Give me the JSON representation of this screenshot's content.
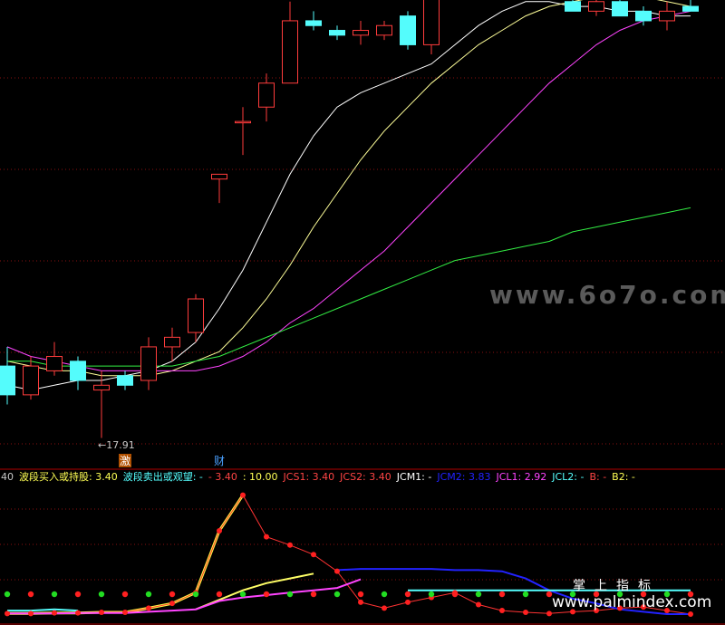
{
  "watermark_main": "www.6o7o.com",
  "watermark_site": "www.palmindex.com",
  "watermark_cn": "掌上指标",
  "price_marker": {
    "label": "←17.91",
    "value": 17.91,
    "index": 4
  },
  "panel_markers": [
    {
      "text": "激",
      "index": 5,
      "color": "#ffffff",
      "bg": "#b05000"
    },
    {
      "text": "财",
      "index": 9,
      "color": "#4aa0ff",
      "bg": ""
    }
  ],
  "indicator_bar": [
    {
      "text": "40",
      "color": "#c8c8c8"
    },
    {
      "text": "波段买入或持股: 3.40",
      "color": "#ffff55"
    },
    {
      "text": "波段卖出或观望: -",
      "color": "#55ffff"
    },
    {
      "text": "- 3.40",
      "color": "#ff4444"
    },
    {
      "text": ": 10.00",
      "color": "#ffff55"
    },
    {
      "text": "JCS1: 3.40",
      "color": "#ff4444"
    },
    {
      "text": "JCS2: 3.40",
      "color": "#ff4444"
    },
    {
      "text": "JCM1: -",
      "color": "#ffffff"
    },
    {
      "text": "JCM2: 3.83",
      "color": "#2222ff"
    },
    {
      "text": "JCL1: 2.92",
      "color": "#ff44ff"
    },
    {
      "text": "JCL2: -",
      "color": "#55ffff"
    },
    {
      "text": "B: -",
      "color": "#ff4444"
    },
    {
      "text": "B2: -",
      "color": "#ffff55"
    }
  ],
  "chart_data": [
    {
      "type": "candlestick",
      "title": "",
      "ylim": [
        17.4,
        27.6
      ],
      "grid": "horizontal dotted",
      "colors": {
        "up": "#ff3c3c",
        "down": "#54fcfc"
      },
      "candles": [
        {
          "open": 19.4,
          "high": 19.8,
          "low": 18.6,
          "close": 18.8
        },
        {
          "open": 18.8,
          "high": 19.6,
          "low": 18.7,
          "close": 19.4
        },
        {
          "open": 19.3,
          "high": 19.9,
          "low": 19.2,
          "close": 19.6
        },
        {
          "open": 19.5,
          "high": 19.6,
          "low": 18.9,
          "close": 19.1
        },
        {
          "open": 18.9,
          "high": 19.3,
          "low": 17.9,
          "close": 19.0
        },
        {
          "open": 19.2,
          "high": 19.3,
          "low": 18.9,
          "close": 19.0
        },
        {
          "open": 19.1,
          "high": 20.0,
          "low": 18.9,
          "close": 19.8
        },
        {
          "open": 19.8,
          "high": 20.2,
          "low": 19.5,
          "close": 20.0
        },
        {
          "open": 20.1,
          "high": 20.9,
          "low": 19.9,
          "close": 20.8
        },
        {
          "open": 23.3,
          "high": 23.4,
          "low": 22.8,
          "close": 23.4
        },
        {
          "open": 24.5,
          "high": 24.8,
          "low": 23.8,
          "close": 24.5
        },
        {
          "open": 24.8,
          "high": 25.5,
          "low": 24.5,
          "close": 25.3
        },
        {
          "open": 25.3,
          "high": 27.0,
          "low": 25.3,
          "close": 26.6
        },
        {
          "open": 26.6,
          "high": 26.8,
          "low": 26.4,
          "close": 26.5
        },
        {
          "open": 26.4,
          "high": 26.5,
          "low": 26.2,
          "close": 26.3
        },
        {
          "open": 26.3,
          "high": 26.6,
          "low": 26.1,
          "close": 26.4
        },
        {
          "open": 26.3,
          "high": 26.6,
          "low": 26.2,
          "close": 26.5
        },
        {
          "open": 26.7,
          "high": 26.8,
          "low": 26.0,
          "close": 26.1
        },
        {
          "open": 26.1,
          "high": 27.4,
          "low": 25.9,
          "close": 27.4
        },
        {
          "open": 27.3,
          "high": 28.6,
          "low": 27.2,
          "close": 27.3
        },
        {
          "open": 27.3,
          "high": 27.6,
          "low": 27.2,
          "close": 27.5
        },
        {
          "open": 27.4,
          "high": 27.8,
          "low": 27.3,
          "close": 27.8
        },
        {
          "open": 27.6,
          "high": 27.9,
          "low": 27.6,
          "close": 27.5
        },
        {
          "open": 27.5,
          "high": 27.6,
          "low": 27.1,
          "close": 27.1
        },
        {
          "open": 27.0,
          "high": 27.1,
          "low": 26.8,
          "close": 26.8
        },
        {
          "open": 26.8,
          "high": 27.1,
          "low": 26.7,
          "close": 27.0
        },
        {
          "open": 27.0,
          "high": 27.1,
          "low": 26.7,
          "close": 26.7
        },
        {
          "open": 26.8,
          "high": 26.9,
          "low": 26.5,
          "close": 26.6
        },
        {
          "open": 26.6,
          "high": 27.0,
          "low": 26.4,
          "close": 26.8
        },
        {
          "open": 26.9,
          "high": 27.2,
          "low": 26.8,
          "close": 26.8
        }
      ],
      "series": [
        {
          "color": "#ffffff",
          "values": [
            19.0,
            18.9,
            19.0,
            19.1,
            19.1,
            19.2,
            19.3,
            19.5,
            19.9,
            20.6,
            21.4,
            22.4,
            23.4,
            24.2,
            24.8,
            25.1,
            25.3,
            25.5,
            25.7,
            26.1,
            26.5,
            26.8,
            27.0,
            27.0,
            26.9,
            26.9,
            26.8,
            26.8,
            26.7,
            26.7
          ]
        },
        {
          "color": "#ffff99",
          "values": [
            19.5,
            19.4,
            19.3,
            19.3,
            19.2,
            19.2,
            19.2,
            19.3,
            19.5,
            19.7,
            20.2,
            20.8,
            21.5,
            22.3,
            23.0,
            23.7,
            24.3,
            24.8,
            25.3,
            25.7,
            26.1,
            26.4,
            26.7,
            26.9,
            27.0,
            27.1,
            27.1,
            27.1,
            27.0,
            26.9
          ]
        },
        {
          "color": "#ff44ff",
          "values": [
            19.8,
            19.6,
            19.5,
            19.4,
            19.3,
            19.3,
            19.3,
            19.3,
            19.3,
            19.4,
            19.6,
            19.9,
            20.3,
            20.6,
            21.0,
            21.4,
            21.8,
            22.3,
            22.8,
            23.3,
            23.8,
            24.3,
            24.8,
            25.3,
            25.7,
            26.1,
            26.4,
            26.6,
            26.7,
            26.8
          ]
        },
        {
          "color": "#33ee44",
          "values": [
            19.5,
            19.5,
            19.4,
            19.4,
            19.4,
            19.4,
            19.4,
            19.4,
            19.5,
            19.6,
            19.8,
            20.0,
            20.2,
            20.4,
            20.6,
            20.8,
            21.0,
            21.2,
            21.4,
            21.6,
            21.7,
            21.8,
            21.9,
            22.0,
            22.2,
            22.3,
            22.4,
            22.5,
            22.6,
            22.7
          ]
        }
      ]
    },
    {
      "type": "line",
      "title": "",
      "ylim": [
        0,
        10.5
      ],
      "grid": "horizontal dotted",
      "series": [
        {
          "name": "JCS1",
          "color": "#ffff44",
          "values": [
            0.05,
            0.05,
            0.1,
            0.1,
            0.15,
            0.15,
            0.5,
            0.9,
            1.8,
            7.0,
            10.0,
            null,
            null,
            null,
            null,
            null,
            null,
            null,
            null,
            null,
            null,
            null,
            null,
            null,
            null,
            null,
            null,
            null,
            null,
            null
          ]
        },
        {
          "name": "JCM1",
          "color": "#ffff66",
          "values": [
            null,
            null,
            null,
            null,
            null,
            null,
            null,
            null,
            0.4,
            1.2,
            2.0,
            2.6,
            3.0,
            3.4,
            null,
            null,
            null,
            null,
            null,
            null,
            null,
            null,
            null,
            null,
            null,
            null,
            null,
            null,
            null,
            null
          ]
        },
        {
          "name": "JCS2",
          "color": "#ff3333",
          "values": [
            0.05,
            0.05,
            0.1,
            0.1,
            0.15,
            0.15,
            0.5,
            0.9,
            1.8,
            7.0,
            10.0,
            6.5,
            5.8,
            5.0,
            3.6,
            1.0,
            0.5,
            1.0,
            1.4,
            1.8,
            0.8,
            0.3,
            0.15,
            0.05,
            0.2,
            0.3,
            0.5,
            0.6,
            0.3,
            0.0
          ]
        },
        {
          "name": "JCM2",
          "color": "#2222ff",
          "values": [
            null,
            null,
            null,
            null,
            null,
            null,
            null,
            null,
            null,
            null,
            null,
            null,
            null,
            null,
            3.7,
            3.8,
            3.8,
            3.8,
            3.8,
            3.7,
            3.7,
            3.6,
            3.0,
            2.0,
            1.3,
            0.9,
            0.4,
            0.2,
            0.0,
            0.0
          ]
        },
        {
          "name": "JCL1",
          "color": "#ff44ff",
          "values": [
            0.05,
            0.05,
            0.05,
            0.1,
            0.1,
            0.1,
            0.2,
            0.3,
            0.4,
            1.1,
            1.4,
            1.6,
            1.8,
            2.0,
            2.2,
            2.92,
            null,
            null,
            null,
            null,
            null,
            null,
            null,
            null,
            null,
            null,
            null,
            null,
            null,
            null
          ]
        },
        {
          "name": "JCL2",
          "color": "#55ffff",
          "values": [
            0.3,
            0.3,
            0.4,
            0.3,
            null,
            null,
            null,
            null,
            null,
            null,
            null,
            null,
            null,
            null,
            null,
            null,
            null,
            2.0,
            2.0,
            2.0,
            2.0,
            2.0,
            2.0,
            2.0,
            2.0,
            2.0,
            2.0,
            2.0,
            2.0,
            2.0
          ]
        }
      ]
    }
  ]
}
